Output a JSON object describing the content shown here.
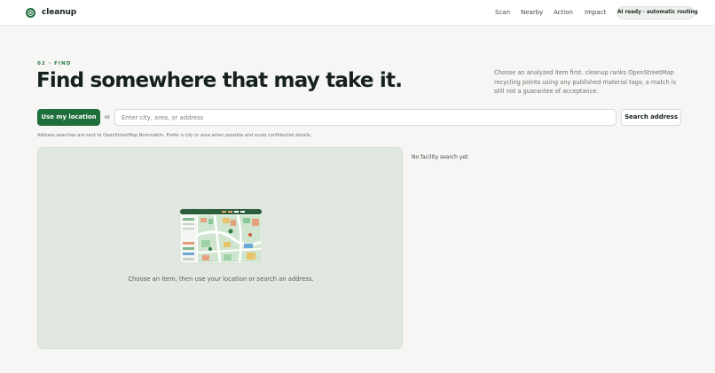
{
  "header": {
    "brand": "cleanup",
    "logo_icon": "recycle-leaf-icon",
    "nav": [
      "Scan",
      "Nearby",
      "Action",
      "Impact"
    ],
    "status": "AI ready · automatic routing"
  },
  "hero": {
    "eyebrow": "02 · FIND",
    "title": "Find somewhere that may take it.",
    "intro": "Choose an analyzed item first. cleanup ranks OpenStreetMap recycling points using any published material tags; a match is still not a guarantee of acceptance."
  },
  "search": {
    "location_button": "Use my location",
    "or_label": "or",
    "placeholder": "Enter city, area, or address",
    "value": "",
    "search_button": "Search address",
    "privacy_note": "Address searches are sent to OpenStreetMap Nominatim. Prefer a city or area when possible and avoid confidential details."
  },
  "map": {
    "illustration": "city-map-illustration-icon",
    "empty_message": "Choose an item, then use your location or search an address."
  },
  "results": {
    "status": "No facility search yet."
  },
  "colors": {
    "accent": "#1f6e3c",
    "eyebrow": "#257a45",
    "background": "#f6f7f4",
    "map_panel": "#e1e8e1"
  }
}
